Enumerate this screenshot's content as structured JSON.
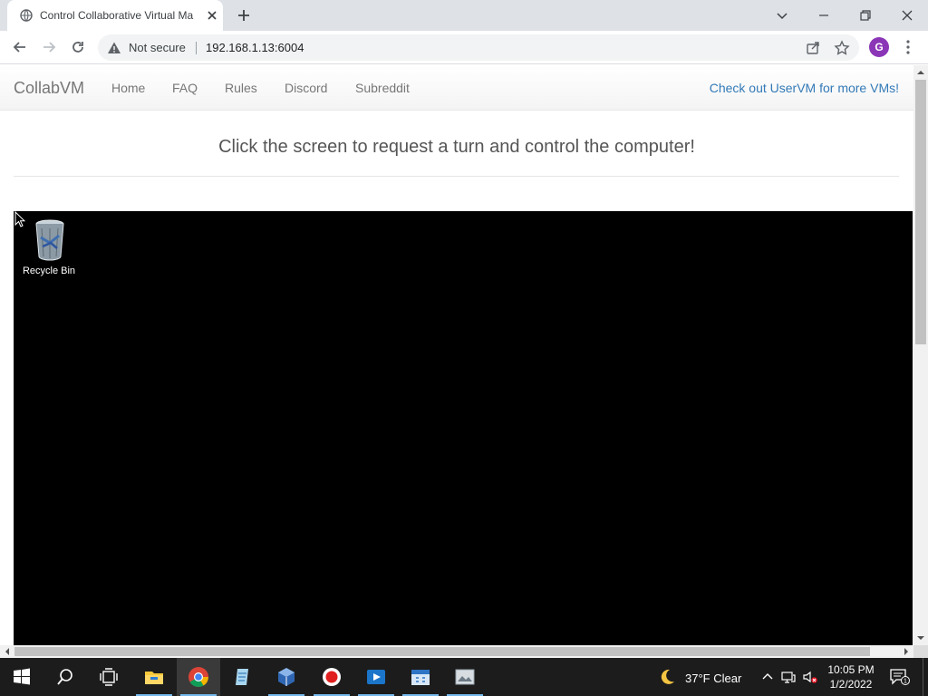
{
  "browser": {
    "tab_title": "Control Collaborative Virtual Ma",
    "security_label": "Not secure",
    "url": "192.168.1.13:6004",
    "profile_initial": "G"
  },
  "site": {
    "brand": "CollabVM",
    "nav": [
      "Home",
      "FAQ",
      "Rules",
      "Discord",
      "Subreddit"
    ],
    "nav_right": "Check out UserVM for more VMs!",
    "headline": "Click the screen to request a turn and control the computer!"
  },
  "vm": {
    "desktop_icons": [
      {
        "label": "Recycle Bin",
        "icon": "recycle-bin-icon"
      }
    ]
  },
  "taskbar": {
    "apps": [
      "start-icon",
      "search-icon",
      "task-view-icon",
      "file-explorer-icon",
      "chrome-icon",
      "notepad-app-icon",
      "virtualbox-icon",
      "record-icon",
      "media-app-icon",
      "calendar-app-icon",
      "photo-app-icon"
    ],
    "active_app": "chrome-icon",
    "weather": "37°F  Clear",
    "time": "10:05 PM",
    "date": "1/2/2022",
    "notification_count": "1"
  },
  "colors": {
    "accent": "#337ab7",
    "taskbar": "#1c1c1c",
    "vm_background": "#000000"
  }
}
